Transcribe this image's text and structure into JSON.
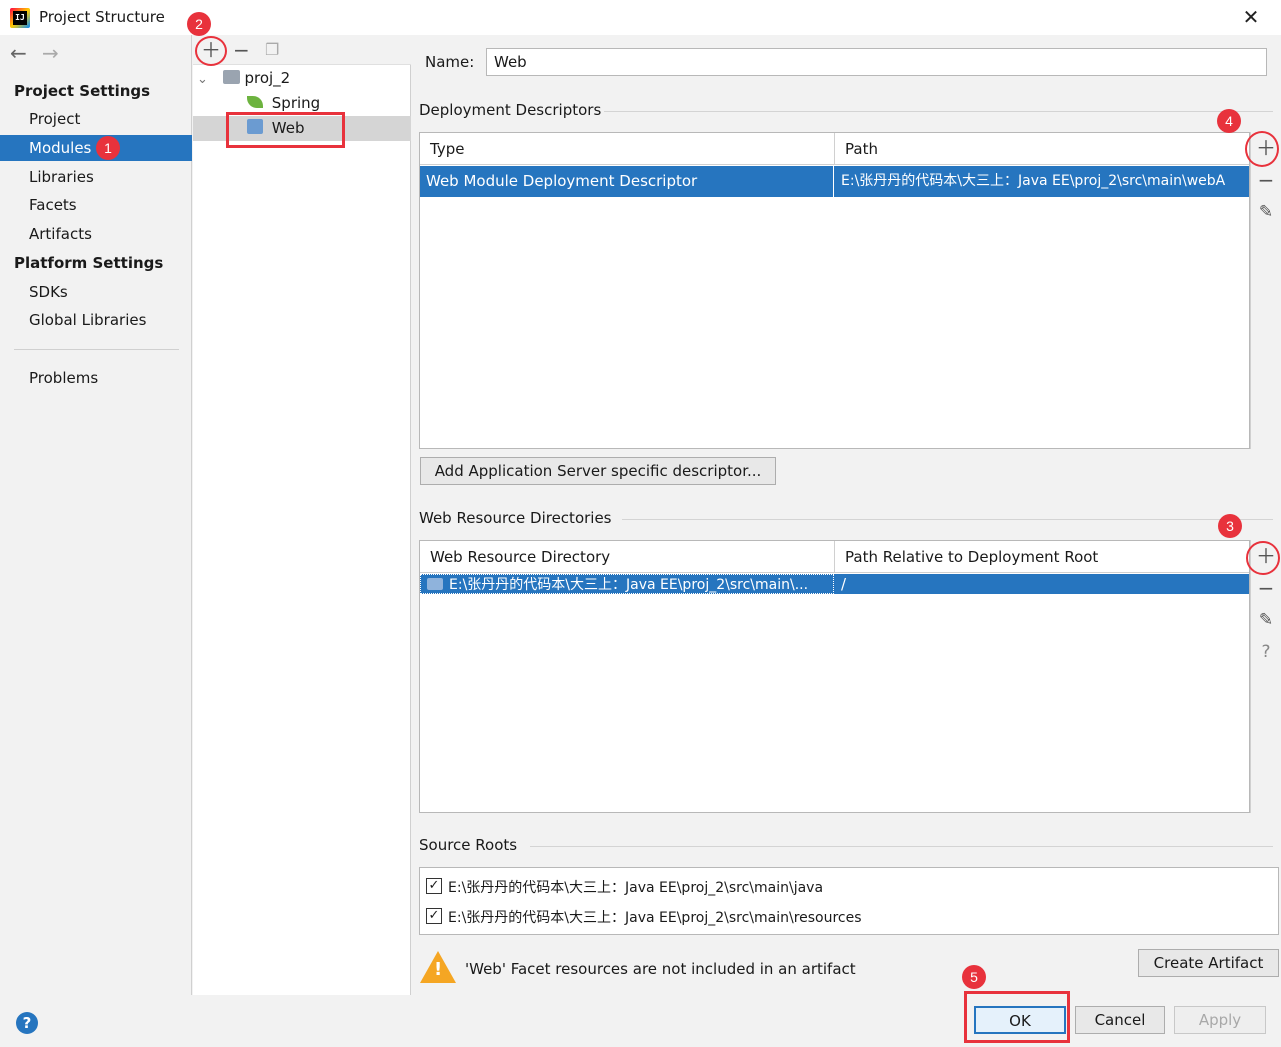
{
  "window": {
    "title": "Project Structure"
  },
  "sidebar": {
    "project_settings_heading": "Project Settings",
    "platform_settings_heading": "Platform Settings",
    "items": [
      {
        "label": "Project"
      },
      {
        "label": "Modules"
      },
      {
        "label": "Libraries"
      },
      {
        "label": "Facets"
      },
      {
        "label": "Artifacts"
      },
      {
        "label": "SDKs"
      },
      {
        "label": "Global Libraries"
      },
      {
        "label": "Problems"
      }
    ]
  },
  "tree": {
    "nodes": [
      {
        "label": "proj_2"
      },
      {
        "label": "Spring"
      },
      {
        "label": "Web"
      }
    ]
  },
  "main": {
    "name_label": "Name:",
    "name_value": "Web",
    "deployment_descriptors": {
      "heading": "Deployment Descriptors",
      "columns": [
        "Type",
        "Path"
      ],
      "rows": [
        {
          "type": "Web Module Deployment Descriptor",
          "path": "E:\\张丹丹的代码本\\大三上：Java EE\\proj_2\\src\\main\\webA"
        }
      ],
      "add_server_button": "Add Application Server specific descriptor..."
    },
    "web_resource_directories": {
      "heading": "Web Resource Directories",
      "columns": [
        "Web Resource Directory",
        "Path Relative to Deployment Root"
      ],
      "rows": [
        {
          "directory": "E:\\张丹丹的代码本\\大三上：Java EE\\proj_2\\src\\main\\...",
          "relative_path": "/"
        }
      ]
    },
    "source_roots": {
      "heading": "Source Roots",
      "items": [
        {
          "path": "E:\\张丹丹的代码本\\大三上：Java EE\\proj_2\\src\\main\\java",
          "checked": true
        },
        {
          "path": "E:\\张丹丹的代码本\\大三上：Java EE\\proj_2\\src\\main\\resources",
          "checked": true
        }
      ]
    },
    "warning_text": "'Web' Facet resources are not included in an artifact",
    "create_artifact_button": "Create Artifact"
  },
  "footer": {
    "ok_button": "OK",
    "cancel_button": "Cancel",
    "apply_button": "Apply"
  },
  "annotations": [
    "1",
    "2",
    "3",
    "4",
    "5"
  ],
  "colors": {
    "accent": "#2675bf",
    "annotation": "#e8323c",
    "warning": "#f5a623"
  }
}
